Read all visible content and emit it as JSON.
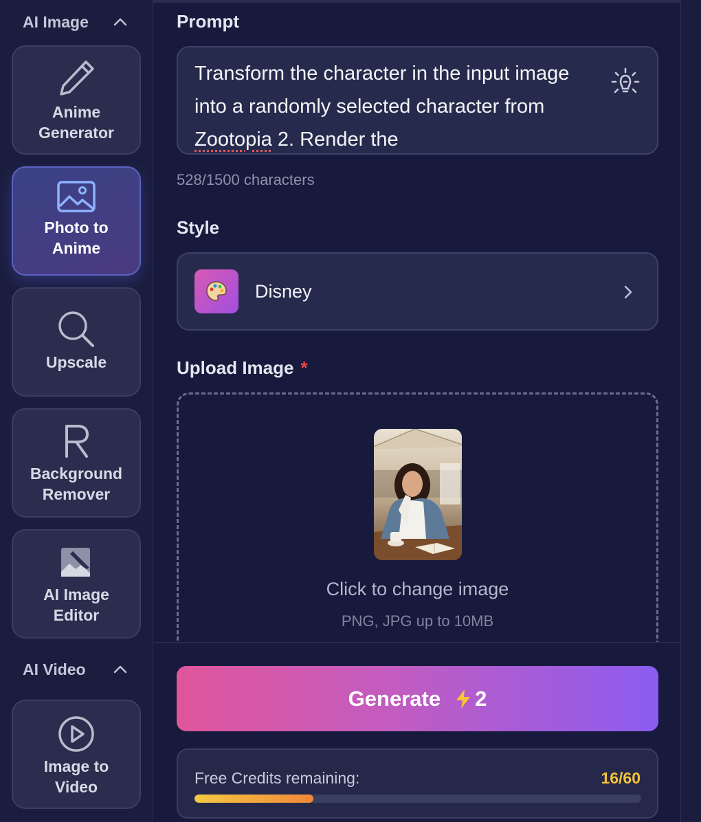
{
  "sidebar": {
    "sections": [
      {
        "title": "AI Image",
        "items": [
          {
            "label_line1": "Anime",
            "label_line2": "Generator",
            "icon": "pencil-icon",
            "active": false
          },
          {
            "label_line1": "Photo to",
            "label_line2": "Anime",
            "icon": "image-icon",
            "active": true
          },
          {
            "label_line1": "Upscale",
            "label_line2": "",
            "icon": "magnifier-icon",
            "active": false
          },
          {
            "label_line1": "Background",
            "label_line2": "Remover",
            "icon": "letter-r-icon",
            "active": false
          },
          {
            "label_line1": "AI Image",
            "label_line2": "Editor",
            "icon": "image-edit-icon",
            "active": false
          }
        ]
      },
      {
        "title": "AI Video",
        "items": [
          {
            "label_line1": "Image to",
            "label_line2": "Video",
            "icon": "play-circle-icon",
            "active": false
          }
        ]
      }
    ]
  },
  "prompt": {
    "label": "Prompt",
    "text_before": "Transform the character in the input image into a randomly selected character from ",
    "text_flagged": "Zootopia",
    "text_after": " 2. Render the",
    "char_count": "528/1500 characters"
  },
  "style": {
    "label": "Style",
    "selected": "Disney",
    "icon": "palette-icon"
  },
  "upload": {
    "label": "Upload Image",
    "required_mark": "*",
    "title": "Click to change image",
    "subtitle": "PNG, JPG up to 10MB"
  },
  "generate": {
    "label": "Generate",
    "cost": "2"
  },
  "credits": {
    "label": "Free Credits remaining:",
    "value": "16/60",
    "fraction": 0.2667
  },
  "colors": {
    "background": "#171a3c",
    "accent_pink": "#e0559b",
    "accent_purple": "#8b5cf0",
    "credits_yellow": "#f5c33b",
    "required_red": "#ef4444"
  }
}
